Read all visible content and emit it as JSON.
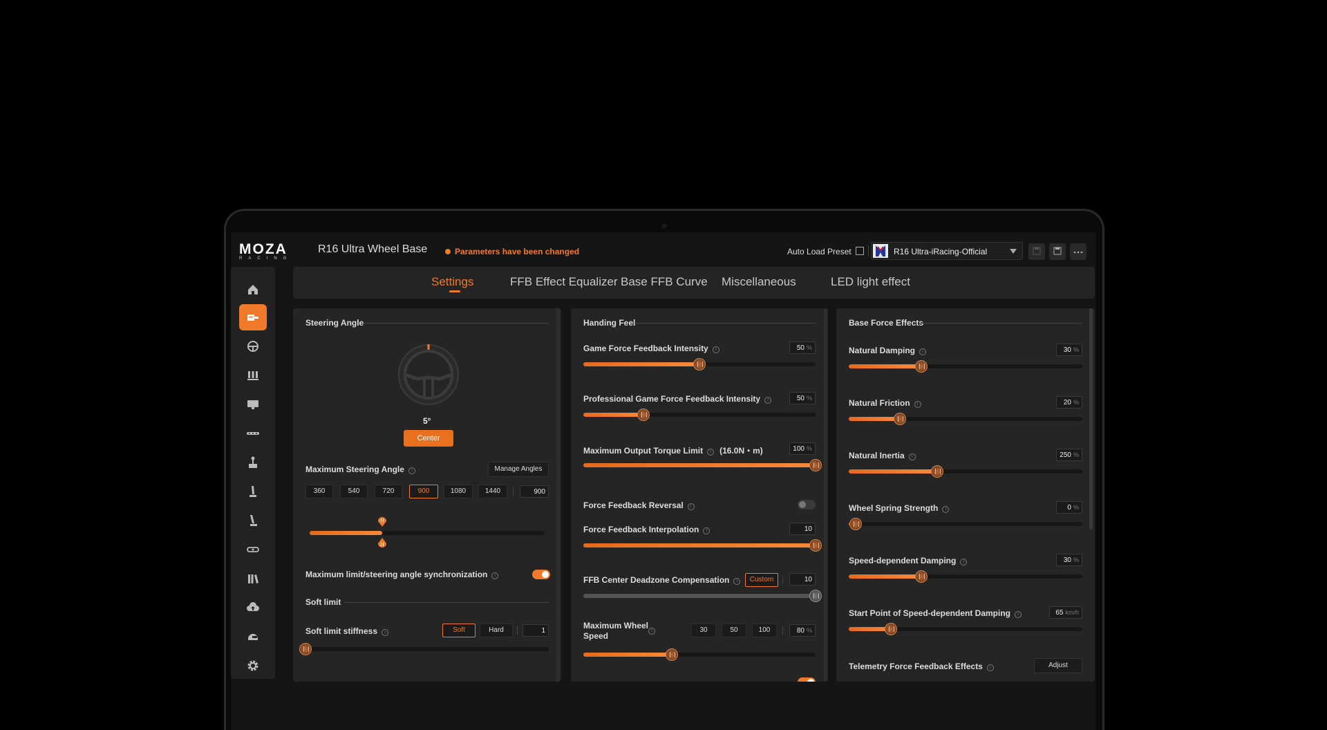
{
  "app": {
    "brand": "MOZA",
    "brand_sub": "RACING",
    "device_name": "R16 Ultra Wheel Base",
    "status_text": "Parameters have been changed",
    "auto_load_label": "Auto Load Preset",
    "preset_value": "R16 Ultra-iRacing-Official",
    "accent": "#f07a2a"
  },
  "sidebar": {
    "items": [
      {
        "name": "home-icon"
      },
      {
        "name": "wheelbase-icon",
        "active": true
      },
      {
        "name": "steering-wheel-icon"
      },
      {
        "name": "pedals-icon"
      },
      {
        "name": "dashboard-icon"
      },
      {
        "name": "led-bar-icon"
      },
      {
        "name": "shifter-icon"
      },
      {
        "name": "handbrake-icon"
      },
      {
        "name": "sequential-shifter-icon"
      },
      {
        "name": "button-box-icon"
      },
      {
        "name": "library-icon"
      },
      {
        "name": "cloud-upload-icon"
      },
      {
        "name": "helmet-icon"
      },
      {
        "name": "settings-icon"
      }
    ]
  },
  "tabs": {
    "items": [
      "Settings",
      "FFB Effect Equalizer",
      "Base FFB Curve",
      "Miscellaneous",
      "LED light effect"
    ],
    "active": 0
  },
  "steering": {
    "section_title": "Steering Angle",
    "current_angle": "5°",
    "center_label": "Center",
    "max_angle_label": "Maximum Steering Angle",
    "manage_label": "Manage Angles",
    "presets": [
      "360",
      "540",
      "720",
      "900",
      "1080",
      "1440"
    ],
    "selected_preset": "900",
    "custom_value": "900",
    "range_fraction": 0.31,
    "sync_label": "Maximum limit/steering angle synchronization",
    "sync_on": true,
    "soft_limit_title": "Soft limit",
    "stiffness_label": "Soft limit stiffness",
    "stiffness_options": [
      "Soft",
      "Hard"
    ],
    "stiffness_selected": "Soft",
    "stiffness_value": "1",
    "stiffness_fraction": 0.0
  },
  "handling": {
    "section_title": "Handing Feel",
    "game_ffb_label": "Game Force Feedback Intensity",
    "game_ffb_value": "50",
    "game_ffb_fraction": 0.5,
    "pro_ffb_label": "Professional Game Force Feedback Intensity",
    "pro_ffb_value": "50",
    "pro_ffb_fraction": 0.26,
    "torque_label": "Maximum Output Torque Limit",
    "torque_extra": "(16.0N・m)",
    "torque_value": "100",
    "torque_fraction": 1.0,
    "reversal_label": "Force Feedback Reversal",
    "reversal_on": false,
    "interp_label": "Force Feedback Interpolation",
    "interp_value": "10",
    "interp_fraction": 1.0,
    "deadzone_label": "FFB Center Deadzone Compensation",
    "deadzone_mode": "Custom",
    "deadzone_value": "10",
    "deadzone_fraction": 1.0,
    "wheelspeed_label_1": "Maximum Wheel",
    "wheelspeed_label_2": "Speed",
    "wheelspeed_options": [
      "30",
      "50",
      "100"
    ],
    "wheelspeed_value": "80",
    "wheelspeed_fraction": 0.38,
    "unit_percent": "%"
  },
  "base_effects": {
    "section_title": "Base Force Effects",
    "damping_label": "Natural Damping",
    "damping_value": "30",
    "damping_fraction": 0.31,
    "friction_label": "Natural Friction",
    "friction_value": "20",
    "friction_fraction": 0.22,
    "inertia_label": "Natural Inertia",
    "inertia_value": "250",
    "inertia_fraction": 0.38,
    "spring_label": "Wheel Spring Strength",
    "spring_value": "0",
    "spring_fraction": 0.03,
    "speed_damping_label": "Speed-dependent Damping",
    "speed_damping_value": "30",
    "speed_damping_fraction": 0.31,
    "start_point_label": "Start Point of Speed-dependent Damping",
    "start_point_value": "65",
    "start_point_unit": "km/h",
    "start_point_fraction": 0.18,
    "telemetry_label": "Telemetry Force Feedback Effects",
    "adjust_label": "Adjust",
    "unit_percent": "%"
  }
}
